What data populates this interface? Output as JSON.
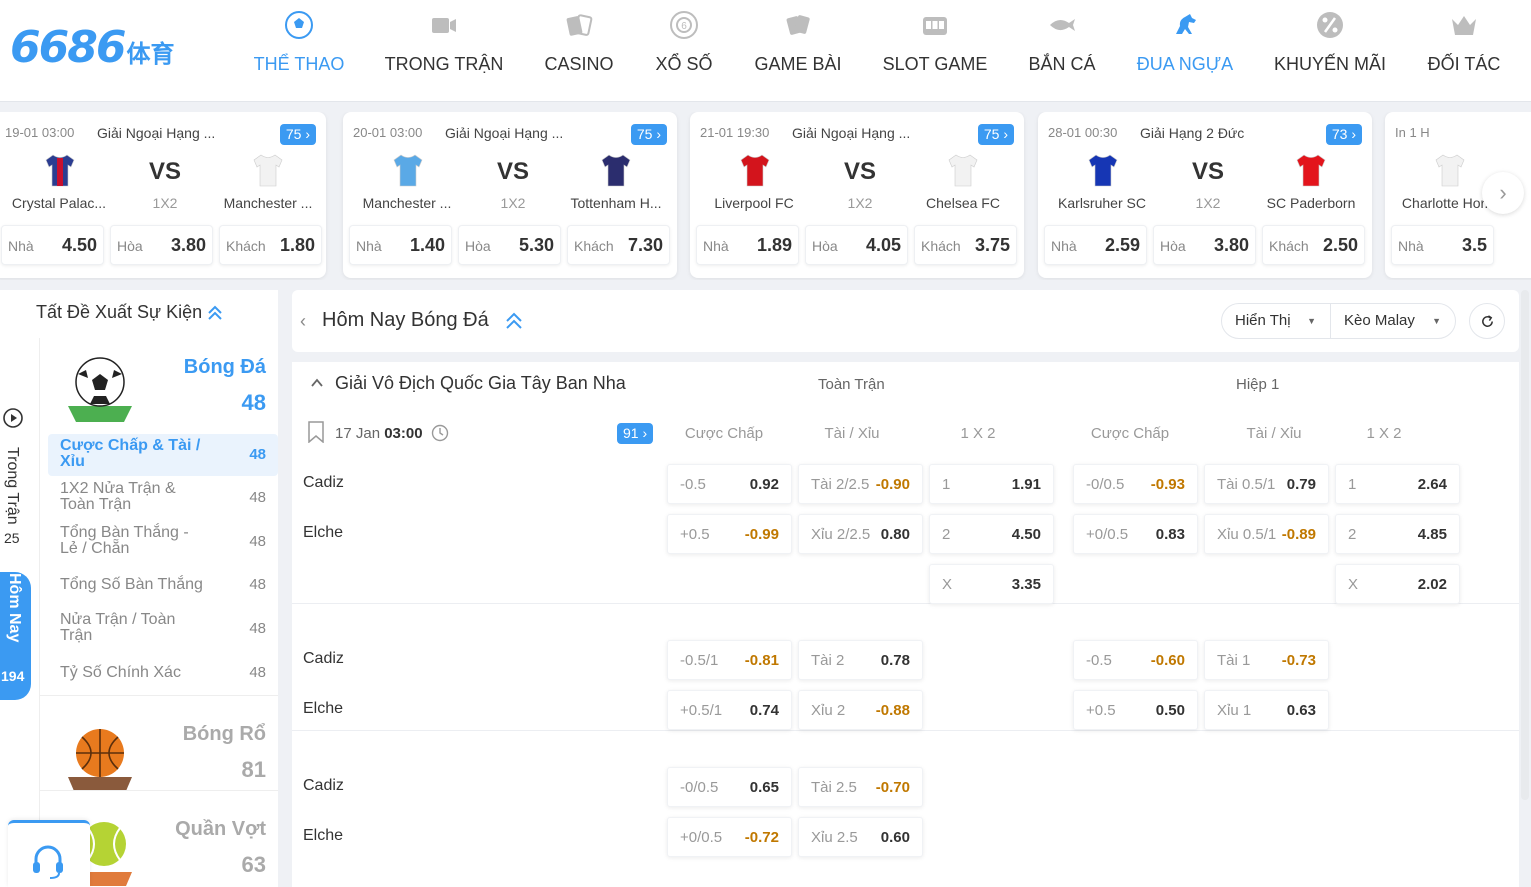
{
  "logo": {
    "main": "6686",
    "sub": "体育"
  },
  "nav": [
    {
      "label": "THỂ THAO",
      "icon": "soccer-ball-icon",
      "active": true
    },
    {
      "label": "TRONG TRẬN",
      "icon": "live-video-icon",
      "active": false
    },
    {
      "label": "CASINO",
      "icon": "playing-cards-icon",
      "active": false
    },
    {
      "label": "XỔ SỐ",
      "icon": "lottery-ball-icon",
      "active": false
    },
    {
      "label": "GAME BÀI",
      "icon": "card-game-icon",
      "active": false
    },
    {
      "label": "SLOT GAME",
      "icon": "slot-machine-icon",
      "active": false
    },
    {
      "label": "BẮN CÁ",
      "icon": "fish-icon",
      "active": false
    },
    {
      "label": "ĐUA NGỰA",
      "icon": "horse-icon",
      "active": true
    },
    {
      "label": "KHUYẾN MÃI",
      "icon": "promo-percent-icon",
      "active": false
    },
    {
      "label": "ĐỐI TÁC",
      "icon": "crown-icon",
      "active": false
    }
  ],
  "matches": [
    {
      "time": "19-01 03:00",
      "league": "Giải Ngoại Hạng ...",
      "count": "75",
      "home": "Crystal Palac...",
      "away": "Manchester ...",
      "vs": "VS",
      "market": "1X2",
      "home_color": "#2b3d91",
      "home_color2": "#c8102e",
      "away_color": "#f2f2f2",
      "odds": [
        {
          "k": "Nhà",
          "v": "4.50"
        },
        {
          "k": "Hòa",
          "v": "3.80"
        },
        {
          "k": "Khách",
          "v": "1.80"
        }
      ]
    },
    {
      "time": "20-01 03:00",
      "league": "Giải Ngoại Hạng ...",
      "count": "75",
      "home": "Manchester ...",
      "away": "Tottenham H...",
      "vs": "VS",
      "market": "1X2",
      "home_color": "#5aa9e6",
      "home_color2": "#5aa9e6",
      "away_color": "#2b2d6e",
      "odds": [
        {
          "k": "Nhà",
          "v": "1.40"
        },
        {
          "k": "Hòa",
          "v": "5.30"
        },
        {
          "k": "Khách",
          "v": "7.30"
        }
      ]
    },
    {
      "time": "21-01 19:30",
      "league": "Giải Ngoại Hạng ...",
      "count": "75",
      "home": "Liverpool FC",
      "away": "Chelsea FC",
      "vs": "VS",
      "market": "1X2",
      "home_color": "#d3141c",
      "home_color2": "#d3141c",
      "away_color": "#f2f2f2",
      "odds": [
        {
          "k": "Nhà",
          "v": "1.89"
        },
        {
          "k": "Hòa",
          "v": "4.05"
        },
        {
          "k": "Khách",
          "v": "3.75"
        }
      ]
    },
    {
      "time": "28-01 00:30",
      "league": "Giải Hạng 2 Đức",
      "count": "73",
      "home": "Karlsruher SC",
      "away": "SC Paderborn",
      "vs": "VS",
      "market": "1X2",
      "home_color": "#1636b4",
      "home_color2": "#1636b4",
      "away_color": "#e3141c",
      "odds": [
        {
          "k": "Nhà",
          "v": "2.59"
        },
        {
          "k": "Hòa",
          "v": "3.80"
        },
        {
          "k": "Khách",
          "v": "2.50"
        }
      ]
    },
    {
      "time": "In 1 H",
      "league": "",
      "count": "",
      "home": "Charlotte Hor...",
      "away": "",
      "vs": "",
      "market": "",
      "home_color": "#f2f2f2",
      "home_color2": "#f2f2f2",
      "away_color": "",
      "odds": [
        {
          "k": "Nhà",
          "v": "3.5"
        }
      ]
    }
  ],
  "sidebar": {
    "title": "Tất Đề Xuất Sự Kiện",
    "live_label": "Trong Trận",
    "live_count": "25",
    "today_label": "Hôm Nay",
    "today_count": "194",
    "sports": [
      {
        "name": "Bóng Đá",
        "count": "48",
        "color": "#3b9af2",
        "icon": "soccer-field-icon"
      },
      {
        "name": "Bóng Rổ",
        "count": "81",
        "color": "#aaaaaa",
        "icon": "basketball-court-icon"
      },
      {
        "name": "Quần Vợt",
        "count": "63",
        "color": "#aaaaaa",
        "icon": "tennis-court-icon"
      }
    ],
    "markets": [
      {
        "label": "Cược Chấp & Tài / Xỉu",
        "count": "48",
        "active": true
      },
      {
        "label": "1X2 Nửa Trận & Toàn Trận",
        "count": "48",
        "active": false
      },
      {
        "label": "Tổng Bàn Thắng - Lẻ / Chẵn",
        "count": "48",
        "active": false
      },
      {
        "label": "Tổng Số Bàn Thắng",
        "count": "48",
        "active": false
      },
      {
        "label": "Nửa Trận / Toàn Trận",
        "count": "48",
        "active": false
      },
      {
        "label": "Tỷ Số Chính Xác",
        "count": "48",
        "active": false
      }
    ]
  },
  "main": {
    "title": "Hôm Nay Bóng Đá",
    "display_select": "Hiển Thị",
    "odds_select": "Kèo Malay",
    "league": "Giải Vô Địch Quốc Gia Tây Ban Nha",
    "full_time": "Toàn Trận",
    "first_half": "Hiệp 1",
    "date": "17 Jan",
    "time": "03:00",
    "market_count": "91",
    "columns_full": [
      "Cược Chấp",
      "Tài / Xỉu",
      "1 X 2"
    ],
    "columns_half": [
      "Cược Chấp",
      "Tài / Xỉu",
      "1 X 2"
    ],
    "groups": [
      {
        "rows": [
          {
            "team": "Cadiz",
            "ft_hdp": {
              "k": "-0.5",
              "v": "0.92"
            },
            "ft_ou": {
              "k": "Tài 2/2.5",
              "v": "-0.90"
            },
            "ft_1x2": {
              "k": "1",
              "v": "1.91"
            },
            "h1_hdp": {
              "k": "-0/0.5",
              "v": "-0.93"
            },
            "h1_ou": {
              "k": "Tài 0.5/1",
              "v": "0.79"
            },
            "h1_1x2": {
              "k": "1",
              "v": "2.64"
            }
          },
          {
            "team": "Elche",
            "ft_hdp": {
              "k": "+0.5",
              "v": "-0.99"
            },
            "ft_ou": {
              "k": "Xỉu 2/2.5",
              "v": "0.80"
            },
            "ft_1x2": {
              "k": "2",
              "v": "4.50"
            },
            "h1_hdp": {
              "k": "+0/0.5",
              "v": "0.83"
            },
            "h1_ou": {
              "k": "Xỉu 0.5/1",
              "v": "-0.89"
            },
            "h1_1x2": {
              "k": "2",
              "v": "4.85"
            }
          },
          {
            "team": "",
            "ft_1x2": {
              "k": "X",
              "v": "3.35"
            },
            "h1_1x2": {
              "k": "X",
              "v": "2.02"
            }
          }
        ]
      },
      {
        "rows": [
          {
            "team": "Cadiz",
            "ft_hdp": {
              "k": "-0.5/1",
              "v": "-0.81"
            },
            "ft_ou": {
              "k": "Tài 2",
              "v": "0.78"
            },
            "h1_hdp": {
              "k": "-0.5",
              "v": "-0.60"
            },
            "h1_ou": {
              "k": "Tài 1",
              "v": "-0.73"
            }
          },
          {
            "team": "Elche",
            "ft_hdp": {
              "k": "+0.5/1",
              "v": "0.74"
            },
            "ft_ou": {
              "k": "Xỉu 2",
              "v": "-0.88"
            },
            "h1_hdp": {
              "k": "+0.5",
              "v": "0.50"
            },
            "h1_ou": {
              "k": "Xỉu 1",
              "v": "0.63"
            }
          }
        ]
      },
      {
        "rows": [
          {
            "team": "Cadiz",
            "ft_hdp": {
              "k": "-0/0.5",
              "v": "0.65"
            },
            "ft_ou": {
              "k": "Tài 2.5",
              "v": "-0.70"
            }
          },
          {
            "team": "Elche",
            "ft_hdp": {
              "k": "+0/0.5",
              "v": "-0.72"
            },
            "ft_ou": {
              "k": "Xỉu 2.5",
              "v": "0.60"
            }
          }
        ]
      }
    ]
  },
  "colors": {
    "accent": "#3b9af2",
    "negative": "#c07800"
  }
}
